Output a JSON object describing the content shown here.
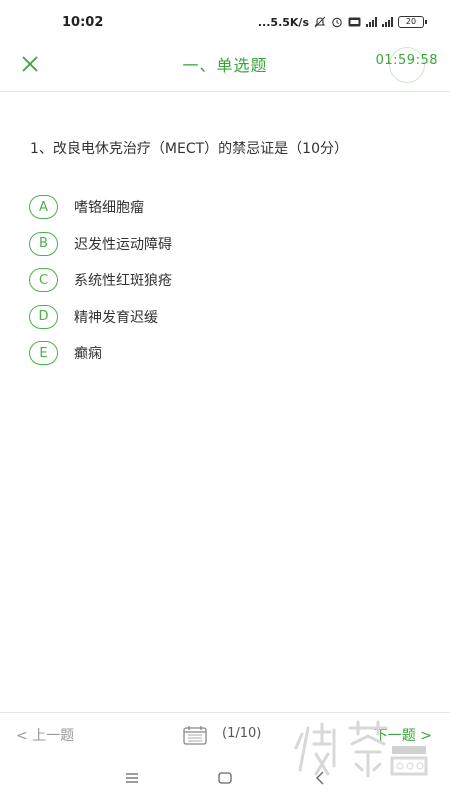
{
  "status_bar": {
    "time": "10:02",
    "network_speed": "...5.5K/s",
    "battery": "20"
  },
  "header": {
    "title": "一、单选题",
    "timer": "01:59:58"
  },
  "question": {
    "text": "1、改良电休克治疗（MECT）的禁忌证是（10分）"
  },
  "options": [
    {
      "letter": "A",
      "text": "嗜铬细胞瘤"
    },
    {
      "letter": "B",
      "text": "迟发性运动障碍"
    },
    {
      "letter": "C",
      "text": "系统性红斑狼疮"
    },
    {
      "letter": "D",
      "text": "精神发育迟缓"
    },
    {
      "letter": "E",
      "text": "癫痫"
    }
  ],
  "bottom_bar": {
    "prev_label": "< 上一题",
    "progress": "(1/10)",
    "next_label": "下一题 >"
  },
  "theme": {
    "accent": "#3aa53a",
    "muted": "#999999"
  }
}
